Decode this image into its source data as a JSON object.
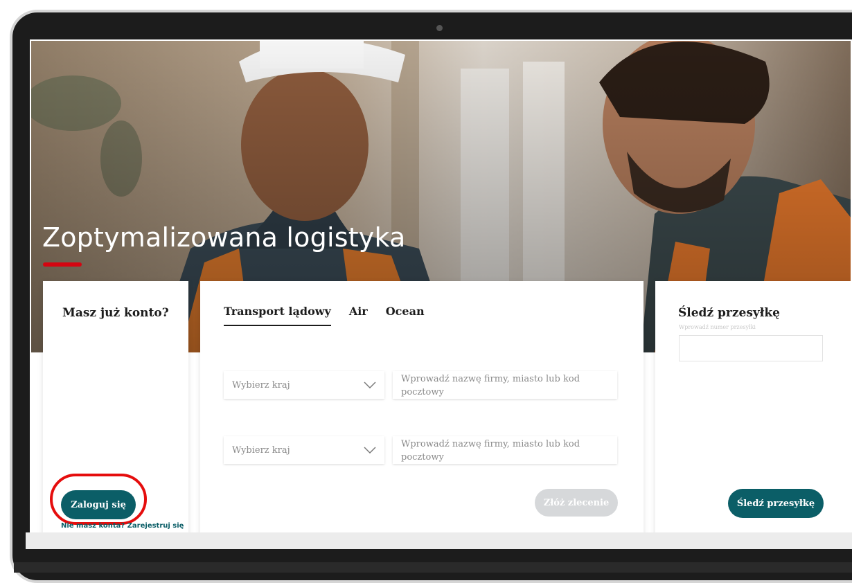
{
  "hero": {
    "title": "Zoptymalizowana logistyka"
  },
  "login": {
    "heading": "Masz już konto?",
    "button_label": "Zaloguj się",
    "no_account_text": "Nie masz konta?",
    "register_link": "Zarejestruj się"
  },
  "order": {
    "tabs": [
      {
        "label": "Transport lądowy",
        "active": true
      },
      {
        "label": "Air",
        "active": false
      },
      {
        "label": "Ocean",
        "active": false
      }
    ],
    "origin": {
      "country_placeholder": "Wybierz kraj",
      "location_placeholder": "Wprowadź nazwę firmy, miasto lub kod pocztowy"
    },
    "destination": {
      "country_placeholder": "Wybierz kraj",
      "location_placeholder": "Wprowadź nazwę firmy, miasto lub kod pocztowy"
    },
    "submit_label": "Złóż zlecenie"
  },
  "tracking": {
    "heading": "Śledź przesyłkę",
    "input_hint": "Wprowadź numer przesyłki",
    "button_label": "Śledź przesyłkę"
  },
  "colors": {
    "accent_teal": "#0b5e67",
    "brand_red": "#d40511",
    "highlight_red": "#e50d0d",
    "disabled_button": "#d6d8da"
  },
  "icons": [
    "chevron-down-icon",
    "camera-icon"
  ]
}
